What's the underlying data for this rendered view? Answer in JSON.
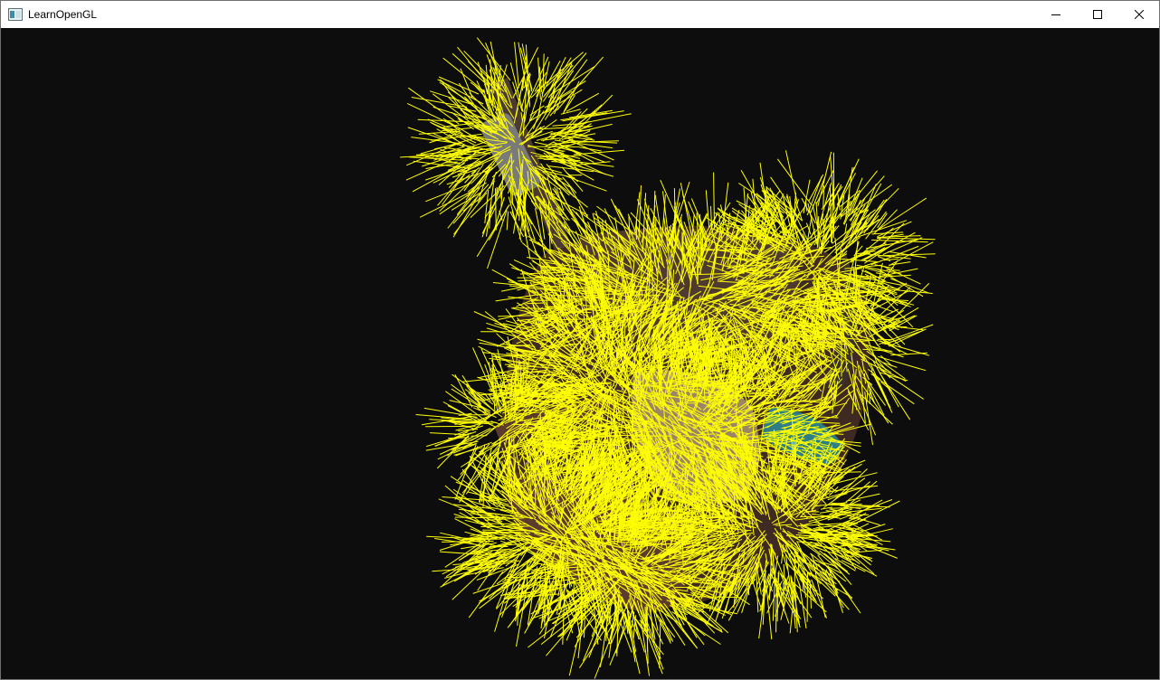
{
  "window": {
    "title": "LearnOpenGL",
    "app_icon": "window-app-icon",
    "controls": [
      {
        "name": "minimize",
        "icon": "minimize-icon"
      },
      {
        "name": "maximize",
        "icon": "maximize-icon"
      },
      {
        "name": "close",
        "icon": "close-icon"
      }
    ]
  },
  "scene": {
    "background_color": "#0d0d0d",
    "normal_line_color": "#ffff00",
    "model_colors": {
      "wood": "#5a3b2e",
      "metal": "#8a8a8a",
      "cloth": "#b69a78",
      "teal": "#2f7e86"
    }
  }
}
